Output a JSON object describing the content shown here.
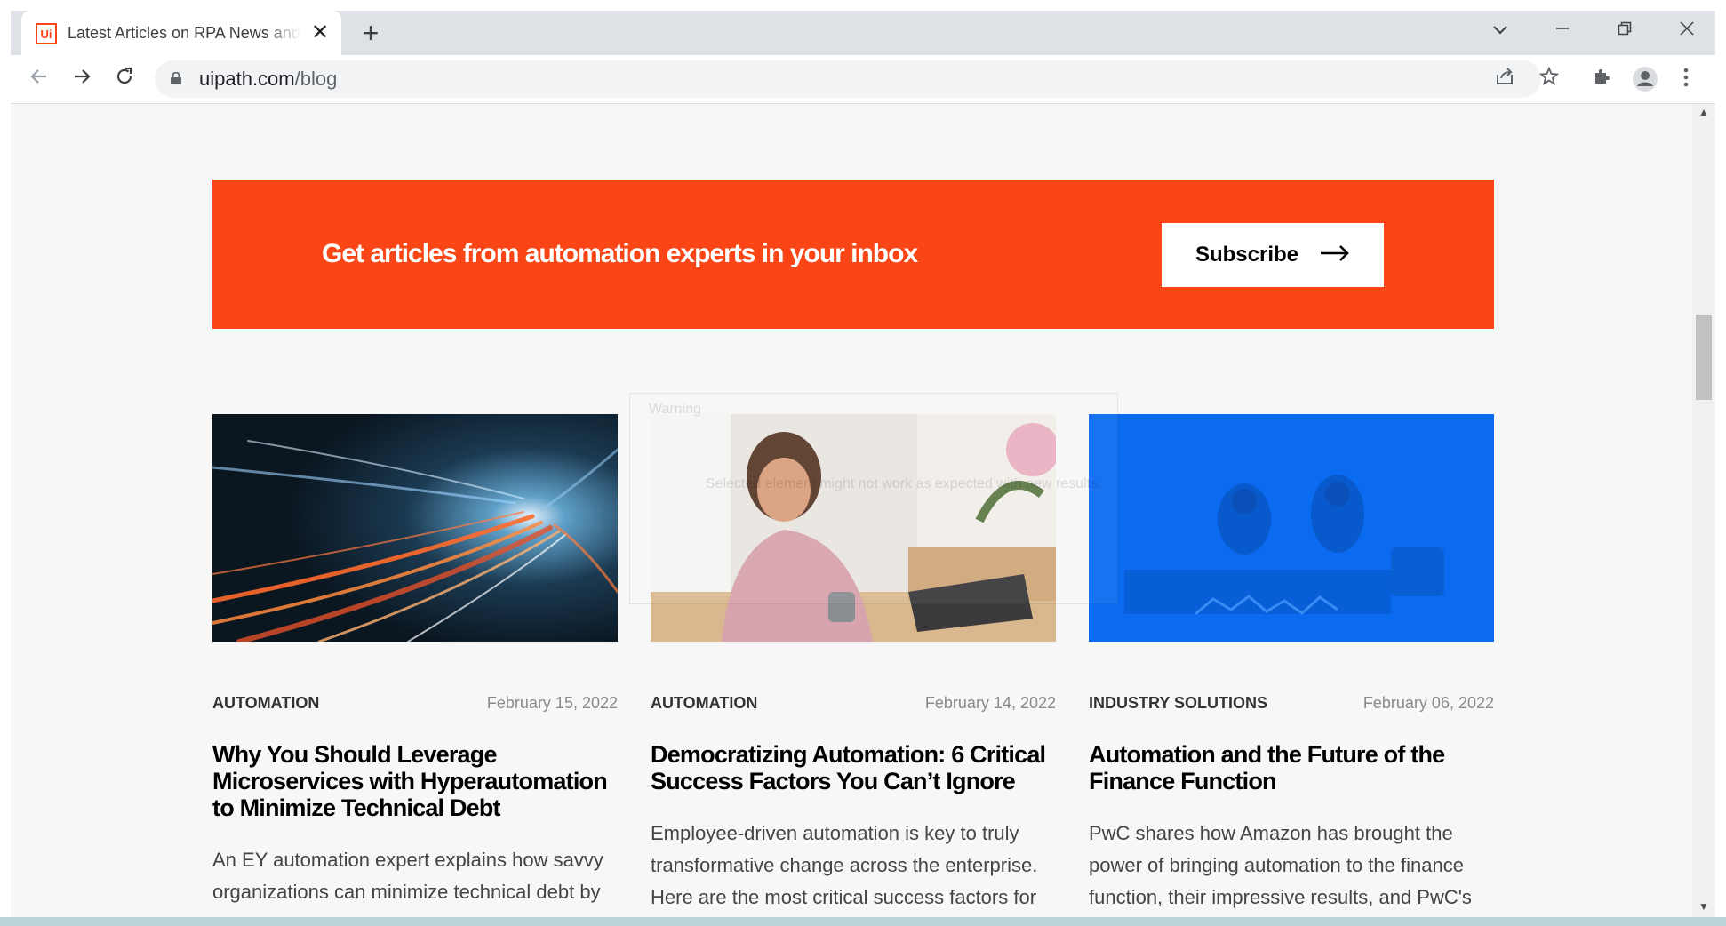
{
  "browser": {
    "tab_title": "Latest Articles on RPA News and Industry Insights",
    "tab_favicon": "Ui",
    "url_domain": "uipath.com",
    "url_path": "/blog",
    "icons": [
      "back-icon",
      "forward-icon",
      "reload-icon",
      "lock-icon",
      "share-icon",
      "star-icon",
      "extensions-icon",
      "profile-icon",
      "menu-icon",
      "minimize-icon",
      "restore-icon",
      "close-icon",
      "tab-search-icon",
      "new-tab-icon"
    ]
  },
  "banner": {
    "text": "Get articles from automation experts in your inbox",
    "button_label": "Subscribe",
    "color": "#fa4616"
  },
  "ghost_dialog": {
    "title": "Warning",
    "message": "Selected element might not work as expected with new results."
  },
  "cards": [
    {
      "tag": "AUTOMATION",
      "date": "February 15, 2022",
      "title": "Why You Should Leverage Microservices with Hyperautomation to Minimize Technical Debt",
      "excerpt": "An EY automation expert explains how savvy organizations can minimize technical debt by",
      "image": "light-trails-tunnel"
    },
    {
      "tag": "AUTOMATION",
      "date": "February 14, 2022",
      "title": "Democratizing Automation: 6 Critical Success Factors You Can’t Ignore",
      "excerpt": "Employee-driven automation is key to truly transformative change across the enterprise. Here are the most critical success factors for",
      "image": "woman-working-laptop"
    },
    {
      "tag": "INDUSTRY SOLUTIONS",
      "date": "February 06, 2022",
      "title": "Automation and the Future of the Finance Function",
      "excerpt": "PwC shares how Amazon has brought the power of bringing automation to the finance function, their impressive results, and PwC's",
      "image": "two-men-on-stage-blue"
    }
  ]
}
